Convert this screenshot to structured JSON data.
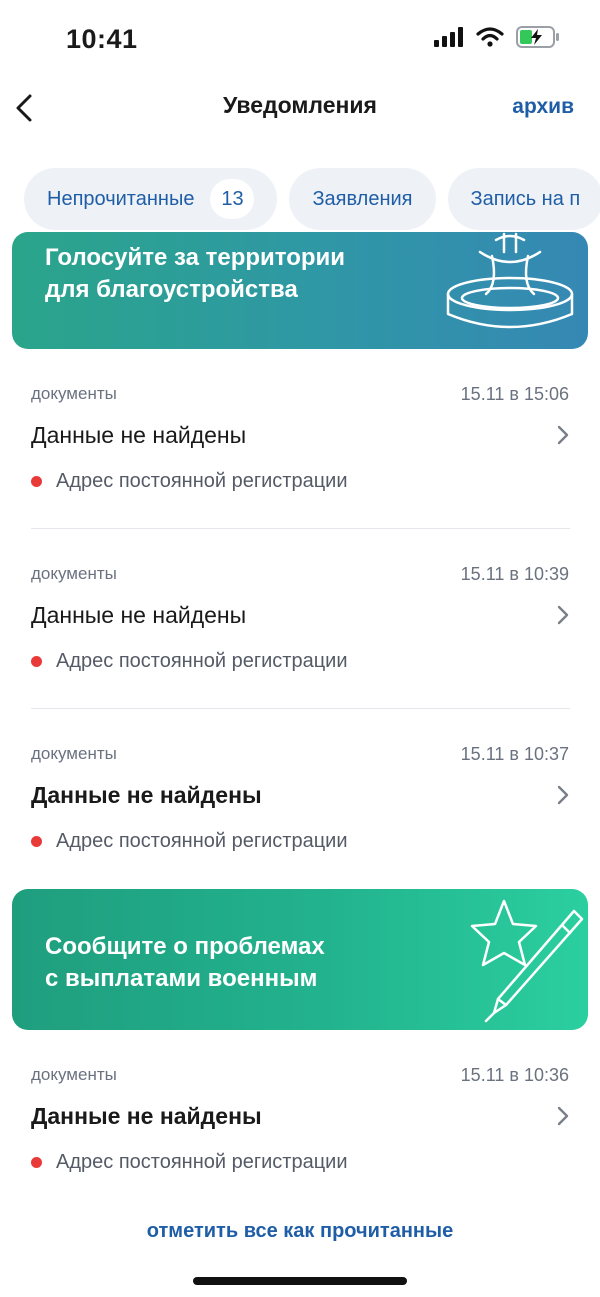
{
  "status_bar": {
    "time": "10:41"
  },
  "nav": {
    "title": "Уведомления",
    "archive_label": "архив"
  },
  "chips": [
    {
      "label": "Непрочитанные",
      "count": "13"
    },
    {
      "label": "Заявления"
    },
    {
      "label": "Запись на п"
    }
  ],
  "banners": [
    {
      "line1": "Голосуйте за территории",
      "line2": "для благоустройства"
    },
    {
      "line1": "Сообщите о проблемах",
      "line2": "с выплатами военным"
    }
  ],
  "notifications": [
    {
      "category": "документы",
      "time": "15.11 в 15:06",
      "title": "Данные не найдены",
      "subtitle": "Адрес постоянной регистрации"
    },
    {
      "category": "документы",
      "time": "15.11 в 10:39",
      "title": "Данные не найдены",
      "subtitle": "Адрес постоянной регистрации"
    },
    {
      "category": "документы",
      "time": "15.11 в 10:37",
      "title": "Данные не найдены",
      "subtitle": "Адрес постоянной регистрации"
    },
    {
      "category": "документы",
      "time": "15.11 в 10:36",
      "title": "Данные не найдены",
      "subtitle": "Адрес постоянной регистрации"
    }
  ],
  "footer": {
    "mark_all_label": "отметить все как прочитанные"
  },
  "colors": {
    "accent": "#1f5ea6",
    "unread_dot": "#e93a3a",
    "chip_bg": "#eef2f7"
  }
}
